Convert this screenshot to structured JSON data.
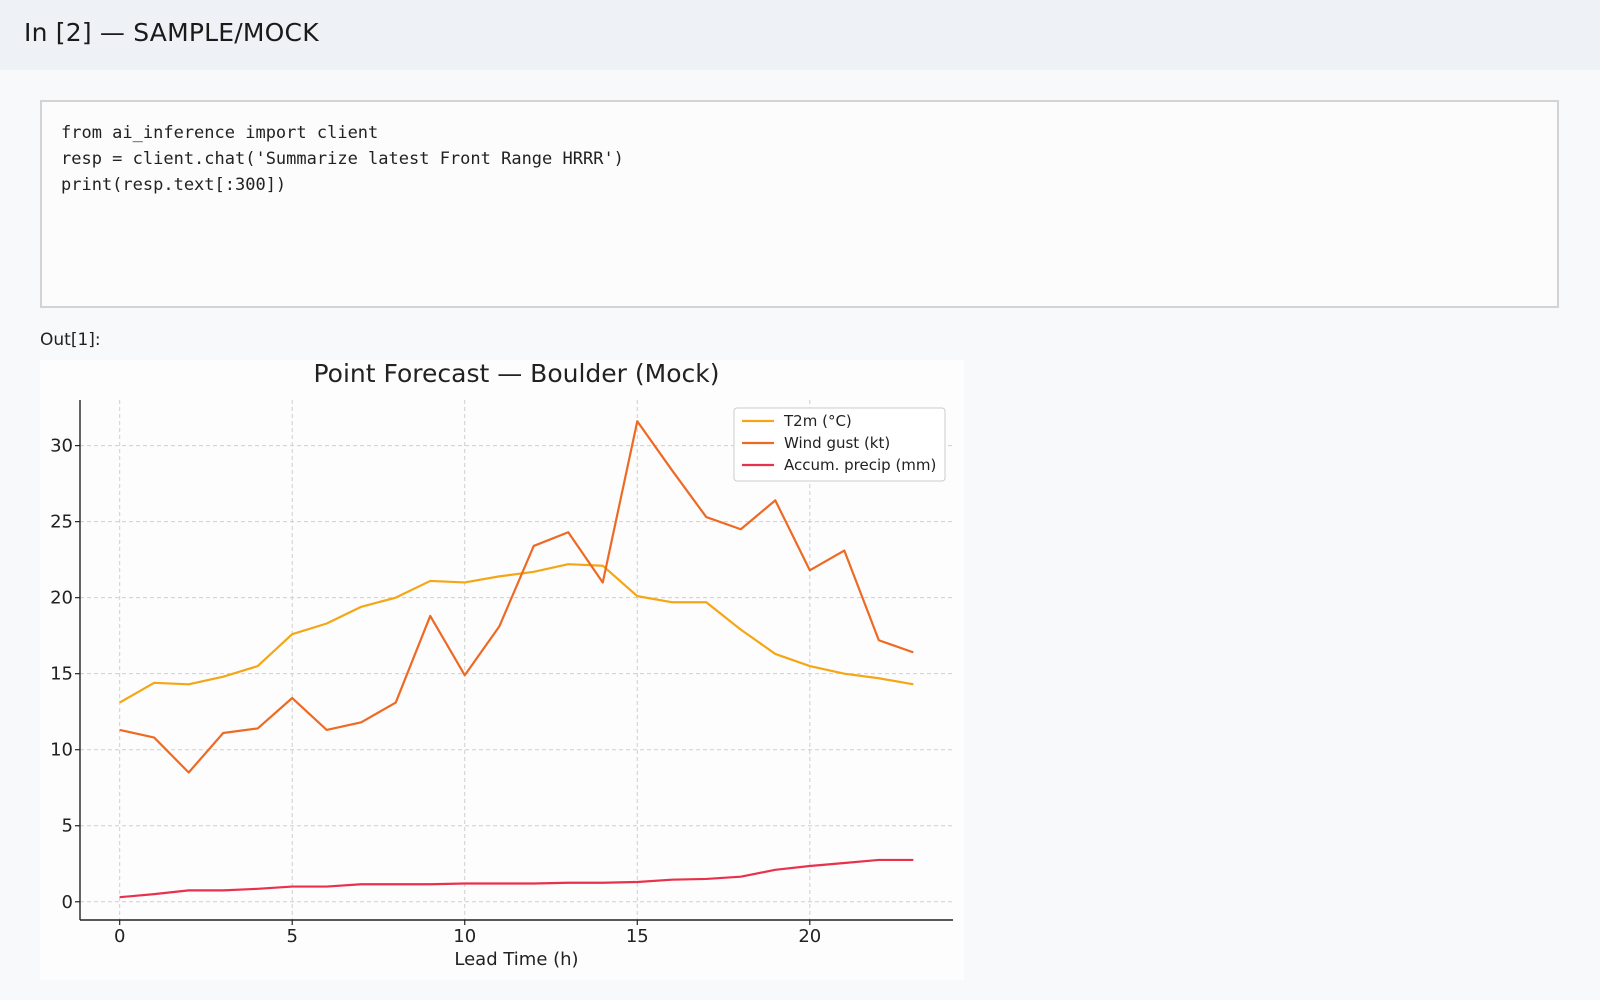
{
  "header": {
    "title": "In [2] — SAMPLE/MOCK"
  },
  "code": {
    "lines": [
      "from ai_inference import client",
      "resp = client.chat('Summarize latest Front Range HRRR')",
      "print(resp.text[:300])"
    ]
  },
  "output": {
    "label": "Out[1]:"
  },
  "chart_data": {
    "type": "line",
    "title": "Point Forecast — Boulder (Mock)",
    "xlabel": "Lead Time (h)",
    "ylabel": "",
    "xlim": [
      -1.15,
      24.15
    ],
    "ylim": [
      -1.2,
      33
    ],
    "xticks": [
      0,
      5,
      10,
      15,
      20
    ],
    "yticks": [
      0,
      5,
      10,
      15,
      20,
      25,
      30
    ],
    "grid": true,
    "legend_position": "top-right",
    "x": [
      0,
      1,
      2,
      3,
      4,
      5,
      6,
      7,
      8,
      9,
      10,
      11,
      12,
      13,
      14,
      15,
      16,
      17,
      18,
      19,
      20,
      21,
      22,
      23
    ],
    "series": [
      {
        "name": "T2m (°C)",
        "color": "#f5a614",
        "values": [
          13.1,
          14.4,
          14.3,
          14.8,
          15.5,
          17.6,
          18.3,
          19.4,
          20.0,
          21.1,
          21.0,
          21.4,
          21.7,
          22.2,
          22.1,
          20.1,
          19.7,
          19.7,
          17.9,
          16.3,
          15.5,
          15.0,
          14.7,
          14.3
        ]
      },
      {
        "name": "Wind gust (kt)",
        "color": "#ee6a24",
        "values": [
          11.3,
          10.8,
          8.5,
          11.1,
          11.4,
          13.4,
          11.3,
          11.8,
          13.1,
          18.8,
          14.9,
          18.1,
          23.4,
          24.3,
          21.0,
          31.6,
          28.4,
          25.3,
          24.5,
          26.4,
          21.8,
          23.1,
          17.2,
          16.4
        ]
      },
      {
        "name": "Accum. precip (mm)",
        "color": "#e8314c",
        "values": [
          0.3,
          0.5,
          0.75,
          0.75,
          0.85,
          1.0,
          1.0,
          1.15,
          1.15,
          1.15,
          1.2,
          1.2,
          1.2,
          1.25,
          1.25,
          1.3,
          1.45,
          1.5,
          1.65,
          2.1,
          2.35,
          2.55,
          2.75,
          2.75
        ]
      }
    ]
  }
}
